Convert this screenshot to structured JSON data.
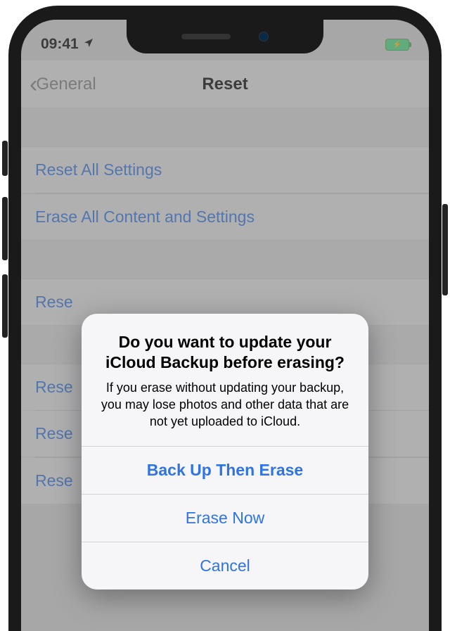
{
  "status": {
    "time": "09:41"
  },
  "nav": {
    "back_label": "General",
    "title": "Reset"
  },
  "rows": {
    "reset_all": "Reset All Settings",
    "erase_all": "Erase All Content and Settings",
    "reset_network": "Reset Network Settings",
    "reset_keyboard": "Reset Keyboard Dictionary",
    "reset_home": "Reset Home Screen Layout",
    "reset_location": "Reset Location & Privacy"
  },
  "rows_truncated": {
    "r3": "Rese",
    "r4": "Rese",
    "r5": "Rese",
    "r6": "Rese"
  },
  "alert": {
    "title": "Do you want to update your iCloud Backup before erasing?",
    "message": "If you erase without updating your backup, you may lose photos and other data that are not yet uploaded to iCloud.",
    "backup_then_erase": "Back Up Then Erase",
    "erase_now": "Erase Now",
    "cancel": "Cancel"
  }
}
